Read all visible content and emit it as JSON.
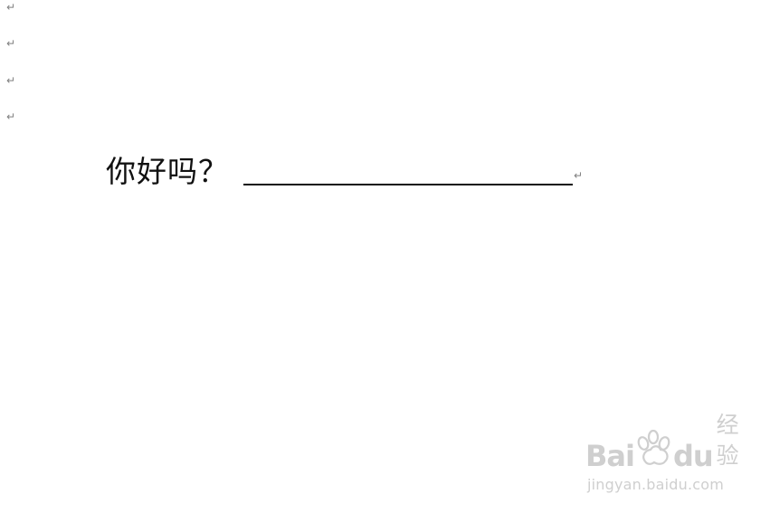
{
  "document": {
    "paragraph_mark": "↵",
    "question": "你好吗？",
    "answer_value": ""
  },
  "watermark": {
    "logo_prefix": "Bai",
    "logo_suffix": "du",
    "service_name": "经验",
    "url": "jingyan.baidu.com"
  },
  "colors": {
    "text": "#111111",
    "formatting_mark": "#7f7f7f",
    "watermark": "#cfcfcf"
  },
  "icons": {
    "paragraph_mark": "paragraph-mark-icon",
    "watermark_logo": "baidu-paw-icon"
  }
}
